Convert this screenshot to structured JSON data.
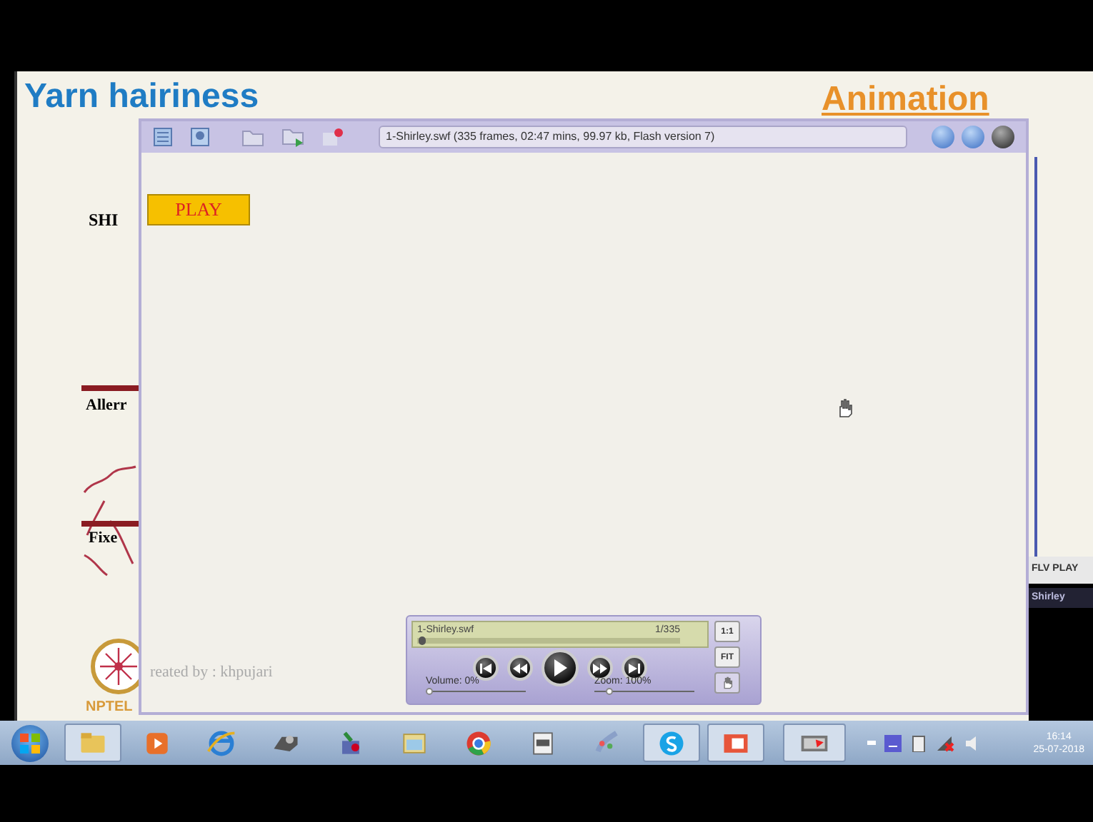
{
  "slide": {
    "title": "Yarn hairiness",
    "heading_right": "Animation",
    "labels": [
      "SHI",
      "Allerr",
      "Fixe"
    ],
    "credit": "reated by : khpujari",
    "logo_text": "NPTEL"
  },
  "flash_window": {
    "info": "1-Shirley.swf (335 frames, 02:47 mins, 99.97 kb, Flash version 7)",
    "play_button": "PLAY",
    "controls": {
      "file": "1-Shirley.swf",
      "frame": "1/335",
      "progress": {
        "level": 0.005
      },
      "volume": {
        "label": "Volume: 0%",
        "level": 0
      },
      "zoom": {
        "label": "Zoom: 100%",
        "level": 0.12
      },
      "side_buttons": [
        "1:1",
        "FIT"
      ]
    }
  },
  "side_panel": {
    "title": "FLV PLAY",
    "item": "Shirley"
  },
  "taskbar": {
    "apps": [
      {
        "kind": "folder",
        "running": true
      },
      {
        "kind": "media",
        "running": false
      },
      {
        "kind": "browser",
        "running": false
      },
      {
        "kind": "scanner",
        "running": false
      },
      {
        "kind": "tool",
        "running": false
      },
      {
        "kind": "window",
        "running": false
      },
      {
        "kind": "chrome",
        "running": false
      },
      {
        "kind": "app",
        "running": false
      },
      {
        "kind": "paint",
        "running": false
      },
      {
        "kind": "chat",
        "running": true
      },
      {
        "kind": "slides",
        "running": true
      },
      {
        "kind": "capture",
        "running": true
      }
    ],
    "clock": {
      "time": "16:14",
      "date": "25-07-2018"
    }
  }
}
